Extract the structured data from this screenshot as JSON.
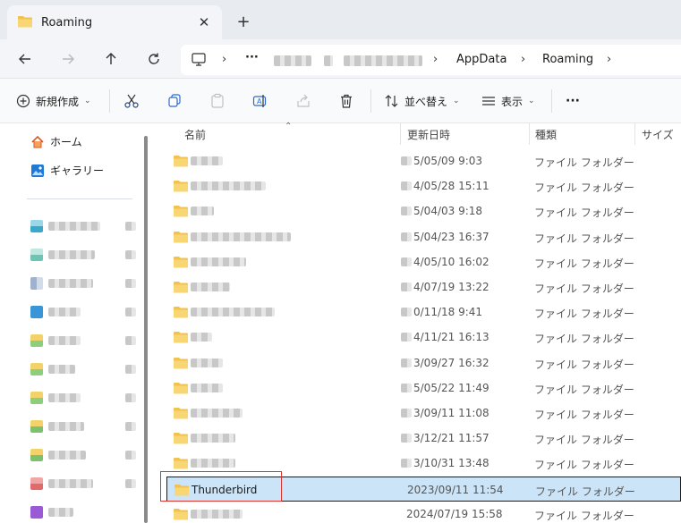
{
  "tab": {
    "title": "Roaming",
    "close": "✕",
    "new": "+"
  },
  "address": {
    "more": "···",
    "crumbs": [
      "AppData",
      "Roaming"
    ],
    "sep": "›"
  },
  "toolbar": {
    "new_label": "新規作成",
    "sort_label": "並べ替え",
    "view_label": "表示",
    "more": "···"
  },
  "nav": {
    "items": [
      {
        "label": "ホーム",
        "icon": "home-icon"
      },
      {
        "label": "ギャラリー",
        "icon": "gallery-icon"
      }
    ]
  },
  "columns": {
    "name": "名前",
    "date": "更新日時",
    "type": "種類",
    "size": "サイズ"
  },
  "rows": [
    {
      "name": "",
      "date": "5/05/09 9:03",
      "type": "ファイル フォルダー"
    },
    {
      "name": "",
      "date": "4/05/28 15:11",
      "type": "ファイル フォルダー"
    },
    {
      "name": "",
      "date": "5/04/03 9:18",
      "type": "ファイル フォルダー"
    },
    {
      "name": "",
      "date": "5/04/23 16:37",
      "type": "ファイル フォルダー"
    },
    {
      "name": "",
      "date": "4/05/10 16:02",
      "type": "ファイル フォルダー"
    },
    {
      "name": "",
      "date": "4/07/19 13:22",
      "type": "ファイル フォルダー"
    },
    {
      "name": "",
      "date": "0/11/18 9:41",
      "type": "ファイル フォルダー"
    },
    {
      "name": "",
      "date": "4/11/21 16:13",
      "type": "ファイル フォルダー"
    },
    {
      "name": "",
      "date": "3/09/27 16:32",
      "type": "ファイル フォルダー"
    },
    {
      "name": "",
      "date": "5/05/22 11:49",
      "type": "ファイル フォルダー"
    },
    {
      "name": "",
      "date": "3/09/11 11:08",
      "type": "ファイル フォルダー"
    },
    {
      "name": "",
      "date": "3/12/21 11:57",
      "type": "ファイル フォルダー"
    },
    {
      "name": "",
      "date": "3/10/31 13:48",
      "type": "ファイル フォルダー"
    },
    {
      "name": "Thunderbird",
      "date": "2023/09/11 11:54",
      "type": "ファイル フォルダー",
      "selected": true
    },
    {
      "name": "",
      "date": "2024/07/19 15:58",
      "type": "ファイル フォルダー"
    }
  ],
  "colors": {
    "folder": "#f2c14e",
    "selection": "#cce4f7",
    "highlight": "#e0332e"
  }
}
